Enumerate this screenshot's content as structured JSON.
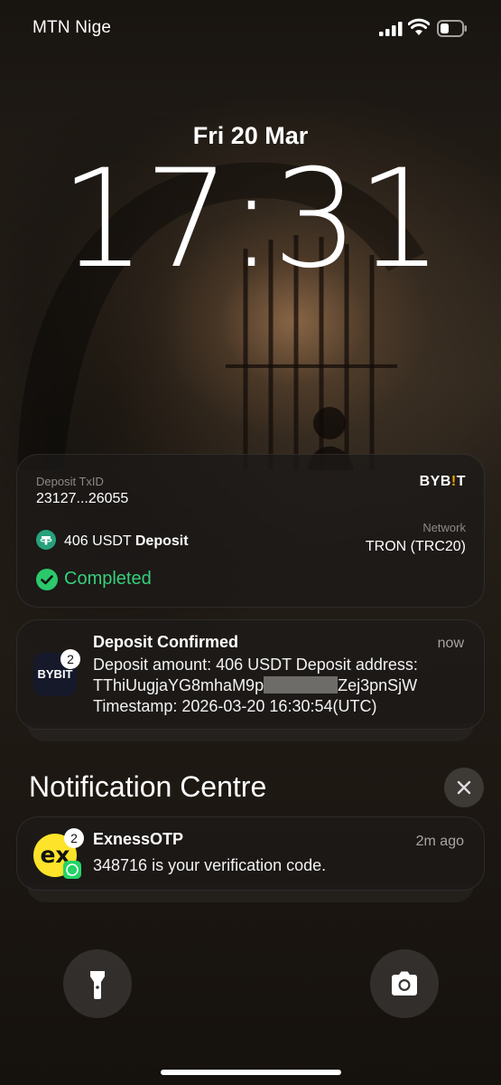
{
  "status_bar": {
    "carrier": "MTN Nige",
    "icons": [
      "signal-icon",
      "wifi-icon",
      "battery-icon"
    ]
  },
  "lock_screen": {
    "date": "Fri 20 Mar",
    "time": "17:31"
  },
  "live_activity": {
    "logo": "BYB",
    "logo_accent": "!",
    "logo_end": "T",
    "txid_label": "Deposit TxID",
    "txid_value": "23127...26055",
    "amount": "406 USDT",
    "amount_suffix": "Deposit",
    "network_label": "Network",
    "network_value": "TRON (TRC20)",
    "status": "Completed",
    "colors": {
      "status": "#35d07a",
      "usdt": "#26a17b",
      "accent": "#f7a600"
    }
  },
  "notification_1": {
    "app_icon_text": "BYBIT",
    "badge": "2",
    "title": "Deposit Confirmed",
    "time": "now",
    "body_line1": "Deposit amount: 406 USDT Deposit address:",
    "body_line2_start": "TThiUugjaYG8mhaM9p",
    "body_line2_end": "Zej3pnSjW",
    "body_line3": "Timestamp: 2026-03-20 16:30:54(UTC)"
  },
  "notification_centre": {
    "title": "Notification Centre",
    "close_icon": "close-icon"
  },
  "notification_2": {
    "app_icon_text": "ex",
    "badge": "2",
    "title": "ExnessOTP",
    "time": "2m ago",
    "body": "348716 is your verification code.",
    "colors": {
      "icon_bg": "#fde32a",
      "whatsapp": "#25d366"
    }
  },
  "bottom_controls": {
    "left": "flashlight-icon",
    "right": "camera-icon"
  }
}
